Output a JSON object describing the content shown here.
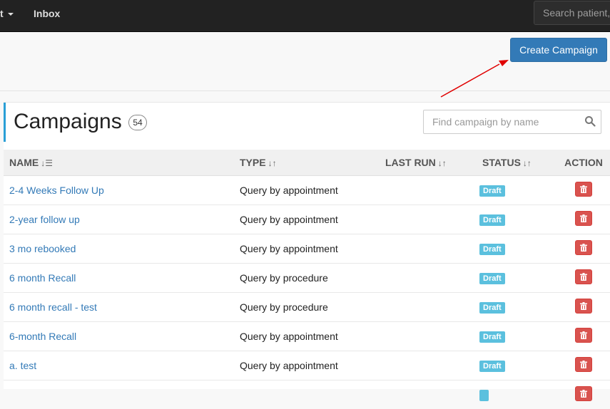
{
  "nav": {
    "dropdown_label": "t",
    "inbox_label": "Inbox",
    "search_placeholder": "Search patient, "
  },
  "toolbar": {
    "create_label": "Create Campaign"
  },
  "page": {
    "title": "Campaigns",
    "count": "54",
    "find_placeholder": "Find campaign by name"
  },
  "table": {
    "headers": {
      "name": "NAME",
      "type": "TYPE",
      "last_run": "LAST RUN",
      "status": "STATUS",
      "action": "ACTION"
    },
    "rows": [
      {
        "name": "2-4 Weeks Follow Up",
        "type": "Query by appointment",
        "last_run": "",
        "status": "Draft"
      },
      {
        "name": "2-year follow up",
        "type": "Query by appointment",
        "last_run": "",
        "status": "Draft"
      },
      {
        "name": "3 mo rebooked",
        "type": "Query by appointment",
        "last_run": "",
        "status": "Draft"
      },
      {
        "name": "6 month Recall",
        "type": "Query by procedure",
        "last_run": "",
        "status": "Draft"
      },
      {
        "name": "6 month recall - test",
        "type": "Query by procedure",
        "last_run": "",
        "status": "Draft"
      },
      {
        "name": "6-month Recall",
        "type": "Query by appointment",
        "last_run": "",
        "status": "Draft"
      },
      {
        "name": "a. test",
        "type": "Query by appointment",
        "last_run": "",
        "status": "Draft"
      },
      {
        "name": "",
        "type": "",
        "last_run": "",
        "status": ""
      }
    ]
  },
  "colors": {
    "primary": "#337ab7",
    "draft": "#5bc0de",
    "danger": "#d9534f",
    "accent": "#2a9fd6",
    "annotation_arrow": "#e00000"
  },
  "icons": {
    "sort_name": "sort-alpha-icon",
    "sort_other": "sort-icon",
    "delete": "trash-icon",
    "search": "search-icon",
    "dropdown": "caret-down-icon"
  }
}
